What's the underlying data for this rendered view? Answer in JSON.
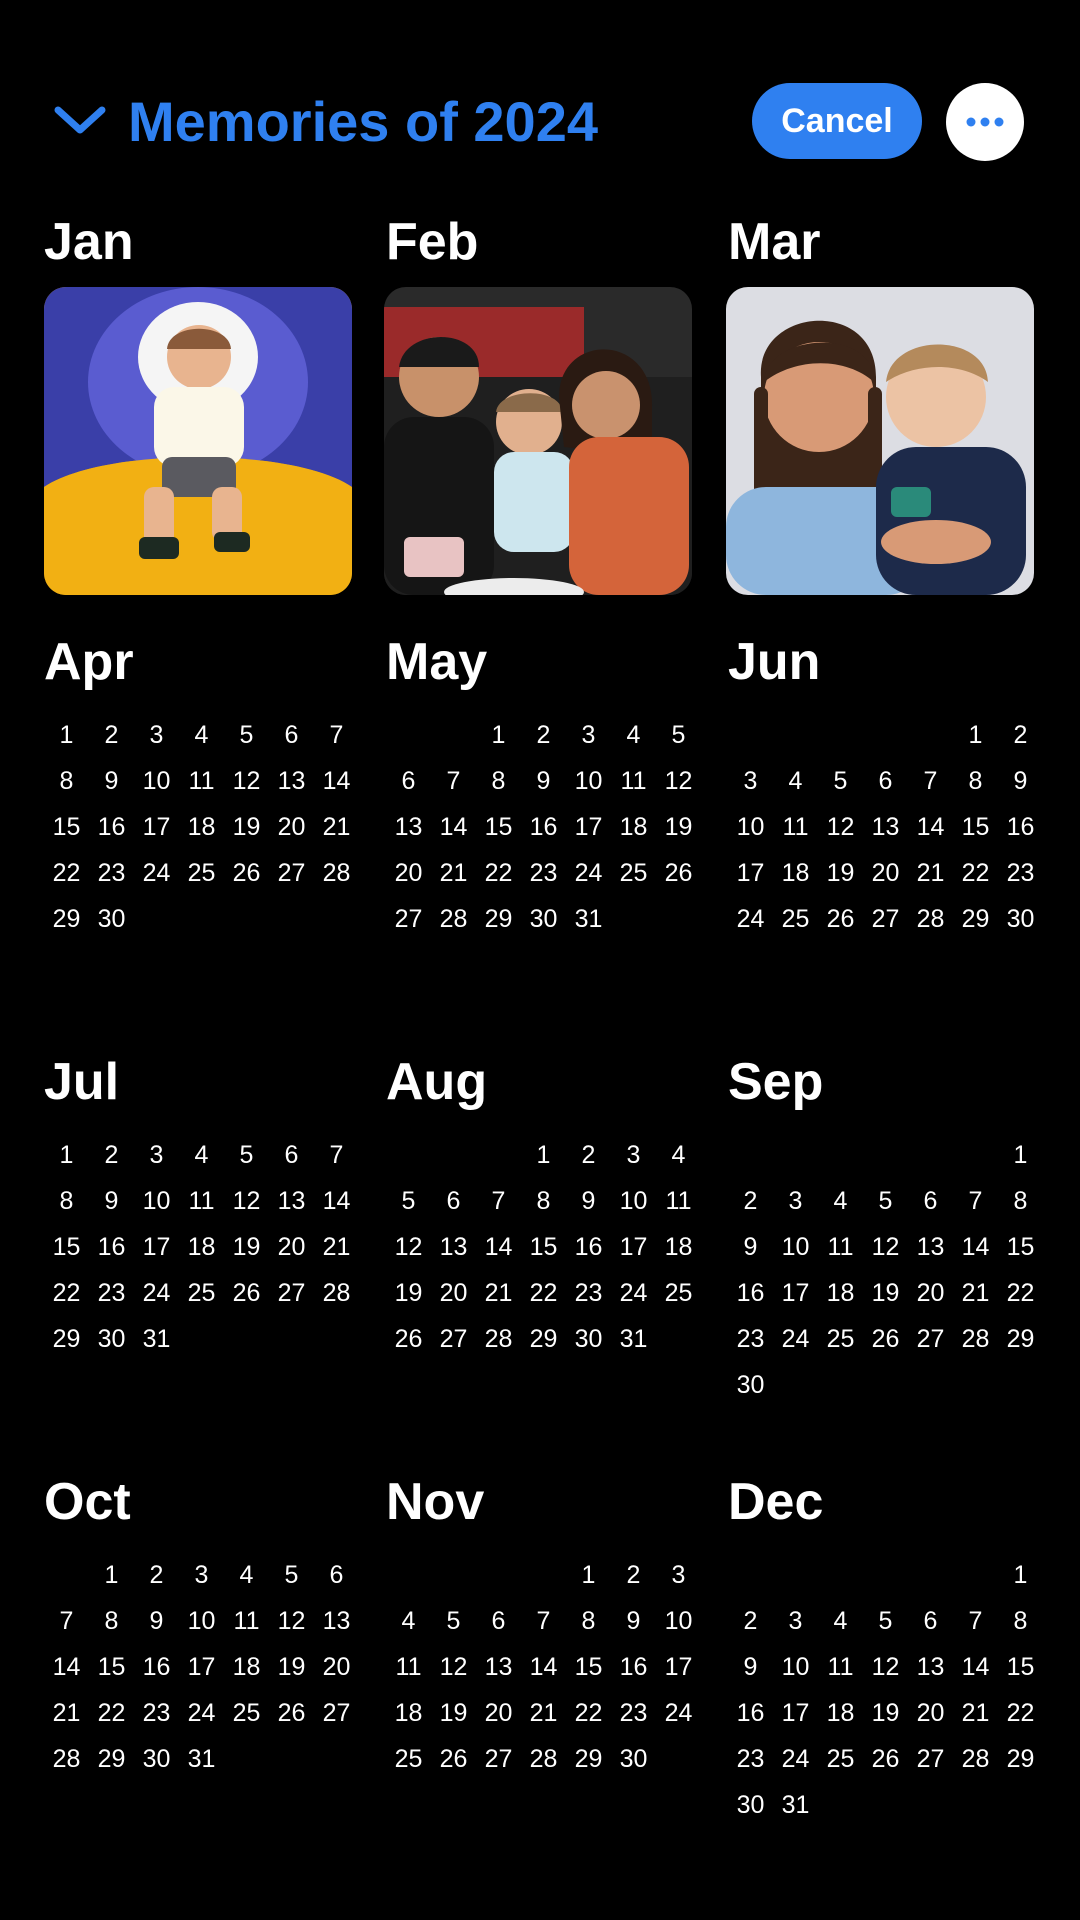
{
  "header": {
    "title": "Memories of 2024",
    "cancel_label": "Cancel",
    "chevron_icon": "chevron-down-icon",
    "more_icon": "ellipsis-icon",
    "accent_color": "#2f80f0"
  },
  "months": [
    {
      "name": "Jan",
      "photo": true
    },
    {
      "name": "Feb",
      "photo": true
    },
    {
      "name": "Mar",
      "photo": true
    },
    {
      "name": "Apr",
      "offset": 0,
      "days": 30
    },
    {
      "name": "May",
      "offset": 2,
      "days": 31
    },
    {
      "name": "Jun",
      "offset": 5,
      "days": 30
    },
    {
      "name": "Jul",
      "offset": 0,
      "days": 31
    },
    {
      "name": "Aug",
      "offset": 3,
      "days": 31
    },
    {
      "name": "Sep",
      "offset": 6,
      "days": 30
    },
    {
      "name": "Oct",
      "offset": 1,
      "days": 31
    },
    {
      "name": "Nov",
      "offset": 4,
      "days": 30
    },
    {
      "name": "Dec",
      "offset": 6,
      "days": 31
    }
  ]
}
